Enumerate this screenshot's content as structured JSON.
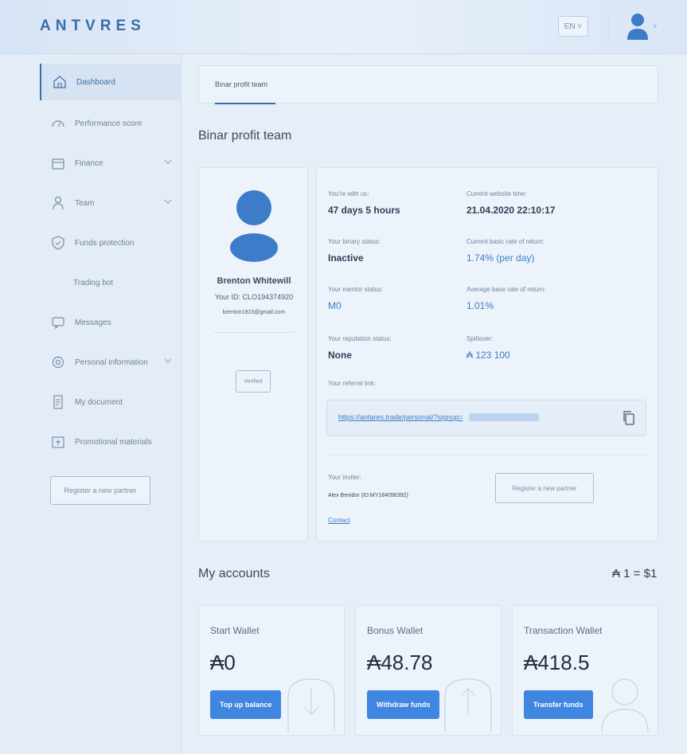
{
  "header": {
    "logo": "ANTVRES",
    "language": "EN ˅"
  },
  "sidebar": {
    "items": [
      {
        "label": "Dashboard",
        "icon": "home-icon"
      },
      {
        "label": "Performance score",
        "icon": "gauge-icon"
      },
      {
        "label": "Finance",
        "icon": "wallet-icon"
      },
      {
        "label": "Team",
        "icon": "person-icon"
      },
      {
        "label": "Funds protection",
        "icon": "shield-icon"
      },
      {
        "label": "Trading bot",
        "icon": ""
      },
      {
        "label": "Messages",
        "icon": "chat-icon"
      },
      {
        "label": "Personal information",
        "icon": "gear-icon"
      },
      {
        "label": "My document",
        "icon": "document-icon"
      },
      {
        "label": "Promotional materials",
        "icon": "promo-icon"
      }
    ],
    "register_button": "Register a new partner"
  },
  "tabs": {
    "active": "Binar profit team"
  },
  "page_title": "Binar profit team",
  "profile": {
    "name": "Brenton Whitewill",
    "id": "Your ID: CLO194374920",
    "email": "brenton1923@gmail.com",
    "verified": "Verified"
  },
  "info": {
    "with_us_label": "You're with us:",
    "with_us_value": "47 days 5 hours",
    "website_time_label": "Current website time:",
    "website_time_value": "21.04.2020 22:10:17",
    "binary_status_label": "Your binary status:",
    "binary_status_value": "Inactive",
    "basic_rate_label": "Current basic rate of return:",
    "basic_rate_value": "1.74% (per day)",
    "mentor_status_label": "Your mentor status:",
    "mentor_status_value": "M0",
    "avg_rate_label": "Average base rate of return:",
    "avg_rate_value": "1.01%",
    "reputation_label": "Your reputation status:",
    "reputation_value": "None",
    "spillover_label": "Spillover:",
    "spillover_value": "₳ 123 100",
    "referral_label": "Your referral link:",
    "referral_link": "https://antares.trade/personal/?signup=",
    "inviter_label": "Your inviter:",
    "inviter_value": "Alex Benidor (ID:MY184096392)",
    "register_button": "Register a new partner",
    "contact": "Contact"
  },
  "accounts": {
    "title": "My accounts",
    "rate": "₳ 1 = $1",
    "wallets": [
      {
        "name": "Start Wallet",
        "amount": "₳0",
        "button": "Top up balance"
      },
      {
        "name": "Bonus Wallet",
        "amount": "₳48.78",
        "button": "Withdraw funds"
      },
      {
        "name": "Transaction Wallet",
        "amount": "₳418.5",
        "button": "Transfer funds"
      }
    ]
  },
  "colors": {
    "accent": "#3e86e0",
    "brand": "#3a6ea8",
    "link": "#3d7cc9"
  }
}
